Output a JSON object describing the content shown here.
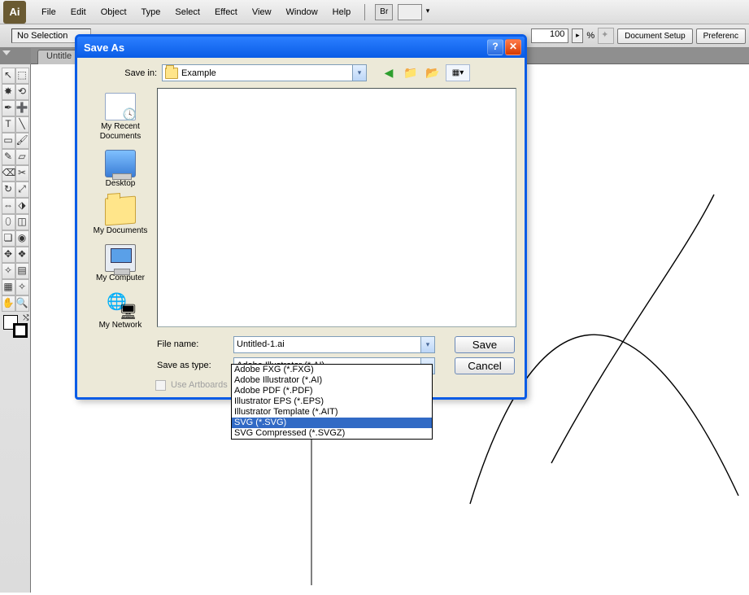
{
  "menu": {
    "items": [
      "File",
      "Edit",
      "Object",
      "Type",
      "Select",
      "Effect",
      "View",
      "Window",
      "Help"
    ],
    "logo": "Ai",
    "br": "Br"
  },
  "optbar": {
    "status": "No Selection",
    "zoom": "100",
    "zoom_unit": "%",
    "doc_setup": "Document Setup",
    "prefs": "Preferenc"
  },
  "tab": {
    "title": "Untitle"
  },
  "dialog": {
    "title": "Save As",
    "savein_label": "Save in:",
    "savein_value": "Example",
    "places": [
      {
        "label": "My Recent Documents",
        "icon": "paper"
      },
      {
        "label": "Desktop",
        "icon": "desktop"
      },
      {
        "label": "My Documents",
        "icon": "mydocs"
      },
      {
        "label": "My Computer",
        "icon": "computer"
      },
      {
        "label": "My Network",
        "icon": "network"
      }
    ],
    "filename_label": "File name:",
    "filename_value": "Untitled-1.ai",
    "type_label": "Save as type:",
    "type_value": "Adobe Illustrator (*.AI)",
    "save": "Save",
    "cancel": "Cancel",
    "use_artboards": "Use Artboards",
    "type_options": [
      "Adobe FXG (*.FXG)",
      "Adobe Illustrator (*.AI)",
      "Adobe PDF (*.PDF)",
      "Illustrator EPS (*.EPS)",
      "Illustrator Template (*.AIT)",
      "SVG (*.SVG)",
      "SVG Compressed (*.SVGZ)"
    ],
    "type_selected_index": 5
  },
  "tools": [
    {
      "g": "↖",
      "n": "selection"
    },
    {
      "g": "⬚",
      "n": "direct-select"
    },
    {
      "g": "✸",
      "n": "magic-wand"
    },
    {
      "g": "⟲",
      "n": "lasso"
    },
    {
      "g": "✒",
      "n": "pen"
    },
    {
      "g": "➕",
      "n": "add-anchor"
    },
    {
      "g": "T",
      "n": "type"
    },
    {
      "g": "╲",
      "n": "line"
    },
    {
      "g": "▭",
      "n": "rectangle"
    },
    {
      "g": "🖌",
      "n": "paintbrush"
    },
    {
      "g": "✎",
      "n": "pencil"
    },
    {
      "g": "▱",
      "n": "blob"
    },
    {
      "g": "⌫",
      "n": "eraser"
    },
    {
      "g": "✂",
      "n": "scissors"
    },
    {
      "g": "↻",
      "n": "rotate"
    },
    {
      "g": "⤢",
      "n": "scale"
    },
    {
      "g": "⇔",
      "n": "width"
    },
    {
      "g": "⬗",
      "n": "free-transform"
    },
    {
      "g": "⬯",
      "n": "shape-builder"
    },
    {
      "g": "◫",
      "n": "perspective"
    },
    {
      "g": "❏",
      "n": "mesh"
    },
    {
      "g": "◉",
      "n": "gradient"
    },
    {
      "g": "✥",
      "n": "eyedropper"
    },
    {
      "g": "❖",
      "n": "blend"
    },
    {
      "g": "✧",
      "n": "symbol-spray"
    },
    {
      "g": "▤",
      "n": "column-graph"
    },
    {
      "g": "▦",
      "n": "artboard"
    },
    {
      "g": "✧",
      "n": "slice"
    },
    {
      "g": "✋",
      "n": "hand"
    },
    {
      "g": "🔍",
      "n": "zoom"
    }
  ]
}
